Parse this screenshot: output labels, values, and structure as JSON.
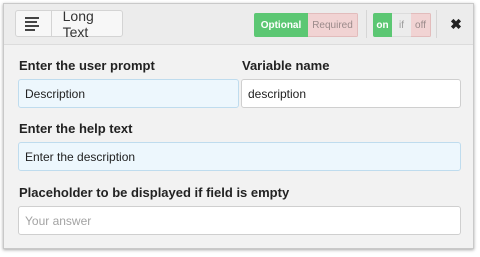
{
  "header": {
    "field_type_icon": "text-lines-icon",
    "field_type_label": "Long Text",
    "required_toggle": {
      "optional_label": "Optional",
      "required_label": "Required",
      "selected": "Optional"
    },
    "visibility_toggle": {
      "on_label": "on",
      "if_label": "if",
      "off_label": "off",
      "selected": "on"
    },
    "close_icon": "close-icon",
    "close_glyph": "✖"
  },
  "form": {
    "prompt_label": "Enter the user prompt",
    "prompt_value": "Description",
    "variable_label": "Variable name",
    "variable_value": "description",
    "help_label": "Enter the help text",
    "help_value": "Enter the description",
    "placeholder_label": "Placeholder to be displayed if field is empty",
    "placeholder_value": "Your answer"
  },
  "colors": {
    "accent_green": "#5cc773",
    "inactive_red": "#f1d3d3",
    "field_tint": "#edf7fd"
  }
}
